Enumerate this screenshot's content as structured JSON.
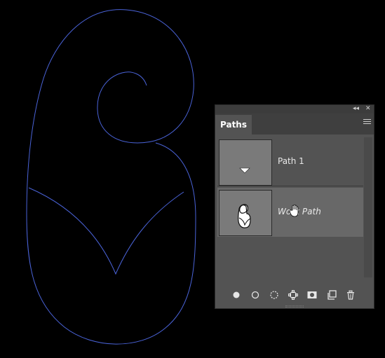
{
  "panel": {
    "collapse_glyph": "◂◂",
    "close_glyph": "✕",
    "tab_label": "Paths",
    "menu_icon": "panel-menu-icon"
  },
  "paths": [
    {
      "name": "Path 1",
      "selected": false
    },
    {
      "name": "Work Path",
      "selected": true
    }
  ],
  "footer_buttons": [
    "fill-path-icon",
    "stroke-path-icon",
    "load-selection-icon",
    "make-work-path-icon",
    "add-mask-icon",
    "new-path-icon",
    "delete-path-icon"
  ],
  "colors": {
    "canvas": "#000000",
    "path_stroke": "#4a63d8",
    "panel_bg": "#535353",
    "selected_row": "#686868"
  }
}
